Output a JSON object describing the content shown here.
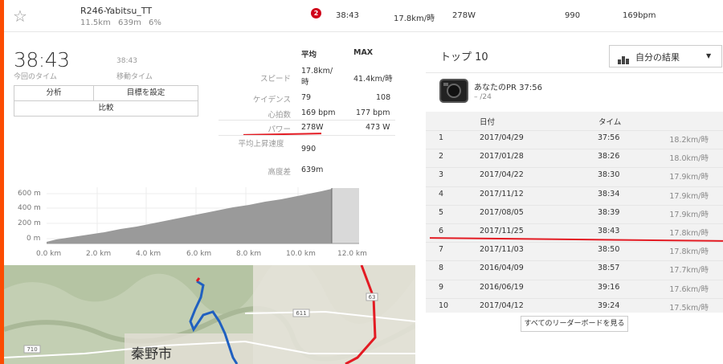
{
  "segment": {
    "name": "R246-Yabitsu_TT",
    "distance": "11.5km",
    "elevation": "639m",
    "grade": "6%",
    "badge": "2",
    "time": "38:43",
    "speed": "17.8km/時",
    "power": "278W",
    "vam": "990",
    "heartrate": "169bpm"
  },
  "effort": {
    "time_big": "38:43",
    "time_label": "今回のタイム",
    "moving_time": "38:43",
    "moving_label": "移動タイム"
  },
  "buttons": {
    "analysis": "分析",
    "set_goal": "目標を設定",
    "compare": "比較"
  },
  "stats": {
    "col_avg": "平均",
    "col_max": "MAX",
    "rows": [
      {
        "label": "スピード",
        "avg": "17.8km/\n時",
        "max": "41.4km/時"
      },
      {
        "label": "ケイデンス",
        "avg": "79",
        "max": "108"
      },
      {
        "label": "心拍数",
        "avg": "169 bpm",
        "max": "177 bpm"
      },
      {
        "label": "パワー",
        "avg": "278W",
        "max": "473 W"
      }
    ],
    "vam_label": "平均上昇速度",
    "vam_value": "990",
    "elev_label": "高度差",
    "elev_value": "639m"
  },
  "elevation_chart": {
    "y_ticks": [
      "600 m",
      "400 m",
      "200 m",
      "0 m"
    ],
    "x_ticks": [
      "0.0 km",
      "2.0 km",
      "4.0 km",
      "6.0 km",
      "8.0 km",
      "10.0 km",
      "12.0 km"
    ],
    "colors": {
      "fill": "#999999",
      "future": "#d9d9d9"
    }
  },
  "map": {
    "city_label": "秦野市",
    "road_labels": [
      "611",
      "710",
      "63"
    ],
    "colors": {
      "route": "#2060c0",
      "road": "#e31b23"
    }
  },
  "leaderboard": {
    "title": "トップ 10",
    "filter": "自分の結果",
    "pr_label": "あなたのPR 37:56",
    "pr_rank": "– /24",
    "headers": {
      "date": "日付",
      "time": "タイム"
    },
    "rows": [
      {
        "rank": "1",
        "date": "2017/04/29",
        "time": "37:56",
        "speed": "18.2km/時"
      },
      {
        "rank": "2",
        "date": "2017/01/28",
        "time": "38:26",
        "speed": "18.0km/時"
      },
      {
        "rank": "3",
        "date": "2017/04/22",
        "time": "38:30",
        "speed": "17.9km/時"
      },
      {
        "rank": "4",
        "date": "2017/11/12",
        "time": "38:34",
        "speed": "17.9km/時"
      },
      {
        "rank": "5",
        "date": "2017/08/05",
        "time": "38:39",
        "speed": "17.9km/時"
      },
      {
        "rank": "6",
        "date": "2017/11/25",
        "time": "38:43",
        "speed": "17.8km/時"
      },
      {
        "rank": "7",
        "date": "2017/11/03",
        "time": "38:50",
        "speed": "17.8km/時"
      },
      {
        "rank": "8",
        "date": "2016/04/09",
        "time": "38:57",
        "speed": "17.7km/時"
      },
      {
        "rank": "9",
        "date": "2016/06/19",
        "time": "39:16",
        "speed": "17.6km/時"
      },
      {
        "rank": "10",
        "date": "2017/04/12",
        "time": "39:24",
        "speed": "17.5km/時"
      }
    ],
    "see_all": "すべてのリーダーボードを見る"
  }
}
